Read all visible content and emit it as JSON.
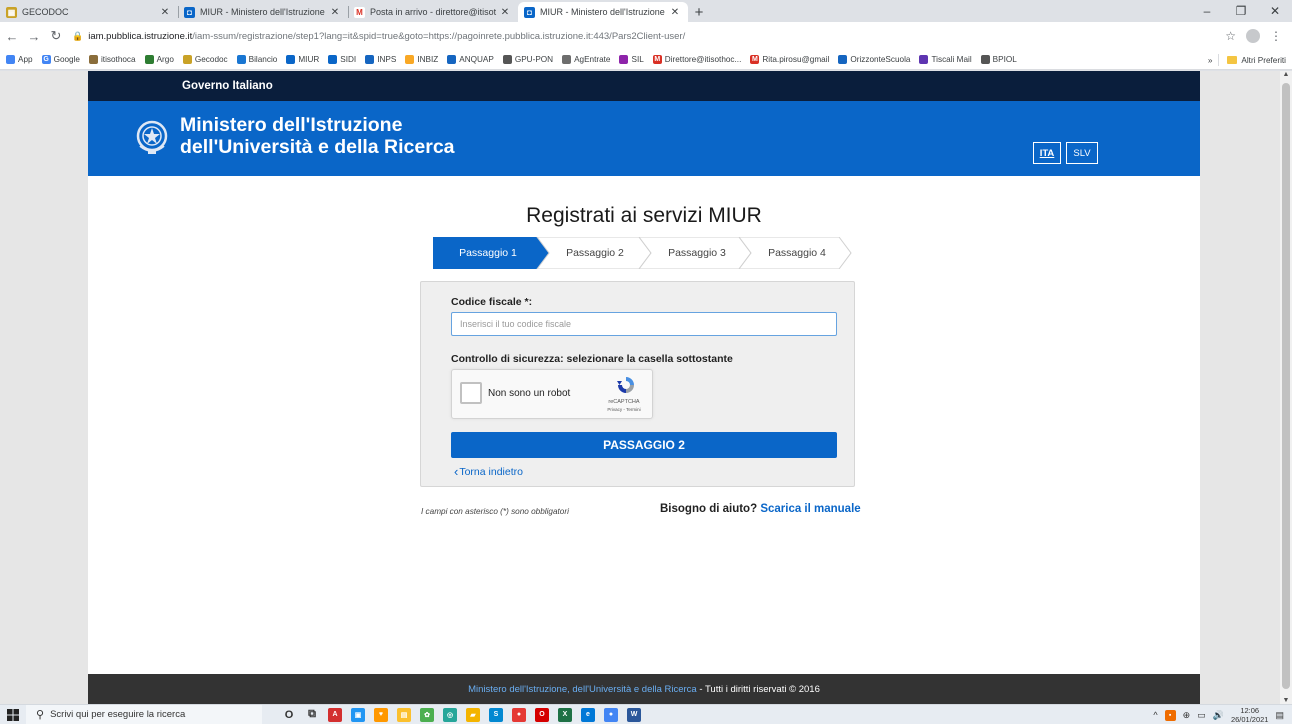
{
  "browser": {
    "tabs": [
      {
        "title": "GECODOC",
        "favicon": "gecodoc",
        "color": "#c9a227"
      },
      {
        "title": "MIUR - Ministero dell'Istruzione",
        "favicon": "miur",
        "color": "#0a66c8"
      },
      {
        "title": "Posta in arrivo - direttore@itisot",
        "favicon": "gmail",
        "color": "#d93025"
      },
      {
        "title": "MIUR - Ministero dell'Istruzione",
        "favicon": "miur",
        "color": "#0a66c8",
        "active": true
      }
    ],
    "url_host": "iam.pubblica.istruzione.it",
    "url_path": "/iam-ssum/registrazione/step1?lang=it&spid=true&goto=https://pagoinrete.pubblica.istruzione.it:443/Pars2Client-user/",
    "bookmarks": [
      {
        "label": "App",
        "color": "#4285f4"
      },
      {
        "label": "Google",
        "color": "#4285f4",
        "glyph": "G"
      },
      {
        "label": "itisothoca",
        "color": "#8a6d3b"
      },
      {
        "label": "Argo",
        "color": "#2e7d32"
      },
      {
        "label": "Gecodoc",
        "color": "#c9a227"
      },
      {
        "label": "Bilancio",
        "color": "#1976d2"
      },
      {
        "label": "MIUR",
        "color": "#0a66c8"
      },
      {
        "label": "SIDI",
        "color": "#0a66c8"
      },
      {
        "label": "INPS",
        "color": "#1565c0"
      },
      {
        "label": "INBIZ",
        "color": "#f9a825"
      },
      {
        "label": "ANQUAP",
        "color": "#1565c0"
      },
      {
        "label": "GPU-PON",
        "color": "#555555"
      },
      {
        "label": "AgEntrate",
        "color": "#6d6d6d"
      },
      {
        "label": "SIL",
        "color": "#8e24aa"
      },
      {
        "label": "Direttore@itisothoc...",
        "color": "#d93025",
        "glyph": "M"
      },
      {
        "label": "Rita.pirosu@gmail",
        "color": "#d93025",
        "glyph": "M"
      },
      {
        "label": "OrizzonteScuola",
        "color": "#1565c0"
      },
      {
        "label": "Tiscali Mail",
        "color": "#5e35b1"
      },
      {
        "label": "BPIOL",
        "color": "#555555"
      }
    ],
    "bookmarks_overflow": "»",
    "other_bookmarks": "Altri Preferiti"
  },
  "site": {
    "gov_label": "Governo Italiano",
    "ministry_line1": "Ministero dell'Istruzione",
    "ministry_line2": "dell'Università e della Ricerca",
    "lang_ita": "ITA",
    "lang_slv": "SLV",
    "page_title": "Registrati ai servizi MIUR",
    "steps": [
      "Passaggio 1",
      "Passaggio 2",
      "Passaggio 3",
      "Passaggio 4"
    ],
    "active_step": 1,
    "accent_color": "#0a66c8",
    "form": {
      "cf_label": "Codice fiscale *:",
      "cf_placeholder": "Inserisci il tuo codice fiscale",
      "cf_value": "",
      "security_label": "Controllo di sicurezza: selezionare la casella sottostante",
      "captcha_label": "Non sono un robot",
      "captcha_brand": "reCAPTCHA",
      "captcha_terms": "Privacy - Termini",
      "submit_label": "PASSAGGIO 2",
      "back_label": "Torna indietro"
    },
    "required_note": "I campi con asterisco (*) sono obbligatori",
    "help_text": "Bisogno di aiuto?",
    "help_link": "Scarica il manuale",
    "footer_link": "Ministero dell'Istruzione, dell'Università e della Ricerca",
    "footer_text": " - Tutti i diritti riservati © 2016"
  },
  "taskbar": {
    "search_placeholder": "Scrivi qui per eseguire la ricerca",
    "apps": [
      {
        "name": "cortana-icon",
        "color": "#333333",
        "glyph": "O"
      },
      {
        "name": "task-view-icon",
        "color": "#333333",
        "glyph": "⧉"
      },
      {
        "name": "acrobat-icon",
        "color": "#d32f2f",
        "glyph": "A"
      },
      {
        "name": "app-icon",
        "color": "#2196f3",
        "glyph": "▣"
      },
      {
        "name": "app-icon",
        "color": "#ff9800",
        "glyph": "♥"
      },
      {
        "name": "sticky-notes-icon",
        "color": "#fbc02d",
        "glyph": "▤"
      },
      {
        "name": "app-icon",
        "color": "#4caf50",
        "glyph": "✿"
      },
      {
        "name": "app-icon",
        "color": "#26a69a",
        "glyph": "◎"
      },
      {
        "name": "file-explorer-icon",
        "color": "#f4b400",
        "glyph": "▰"
      },
      {
        "name": "skype-icon",
        "color": "#0288d1",
        "glyph": "S"
      },
      {
        "name": "chrome-icon",
        "color": "#e53935",
        "glyph": "●"
      },
      {
        "name": "opera-icon",
        "color": "#d50000",
        "glyph": "O"
      },
      {
        "name": "excel-icon",
        "color": "#1e7145",
        "glyph": "X"
      },
      {
        "name": "edge-icon",
        "color": "#0078d7",
        "glyph": "e"
      },
      {
        "name": "chrome-icon",
        "color": "#4285f4",
        "glyph": "●"
      },
      {
        "name": "word-icon",
        "color": "#2b579a",
        "glyph": "W"
      }
    ],
    "time": "12:06",
    "date": "26/01/2021"
  }
}
